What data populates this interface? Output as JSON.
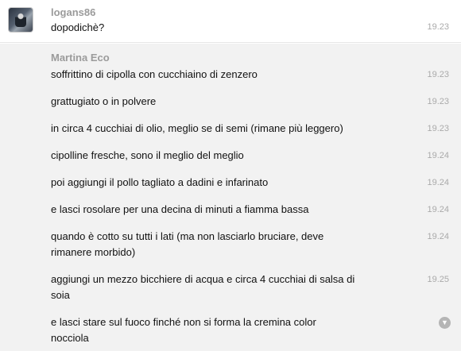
{
  "messages_block_1": {
    "sender": "logans86",
    "messages": [
      {
        "text": "dopodichè?",
        "time": "19.23"
      }
    ]
  },
  "messages_block_2": {
    "sender": "Martina Eco",
    "messages": [
      {
        "text": "soffrittino di cipolla con cucchiaino di zenzero",
        "time": "19.23"
      },
      {
        "text": "grattugiato o in polvere",
        "time": "19.23"
      },
      {
        "text": "in circa 4 cucchiai di olio, meglio se di semi (rimane più leggero)",
        "time": "19.23"
      },
      {
        "text": "cipolline fresche, sono il meglio del meglio",
        "time": "19.24"
      },
      {
        "text": "poi aggiungi il pollo tagliato a dadini e infarinato",
        "time": "19.24"
      },
      {
        "text": "e lasci rosolare per una decina di minuti a fiamma bassa",
        "time": "19.24"
      },
      {
        "text": "quando è cotto su tutti i lati (ma non lasciarlo bruciare, deve rimanere morbido)",
        "time": "19.24"
      },
      {
        "text": "aggiungi un mezzo bicchiere di acqua e circa 4 cucchiai di salsa di soia",
        "time": "19.25"
      },
      {
        "text": "e lasci stare sul fuoco finché non si forma la cremina color nocciola",
        "time": ""
      }
    ]
  },
  "icons": {
    "avatar": "user-avatar",
    "more": "chevron-down-icon"
  }
}
